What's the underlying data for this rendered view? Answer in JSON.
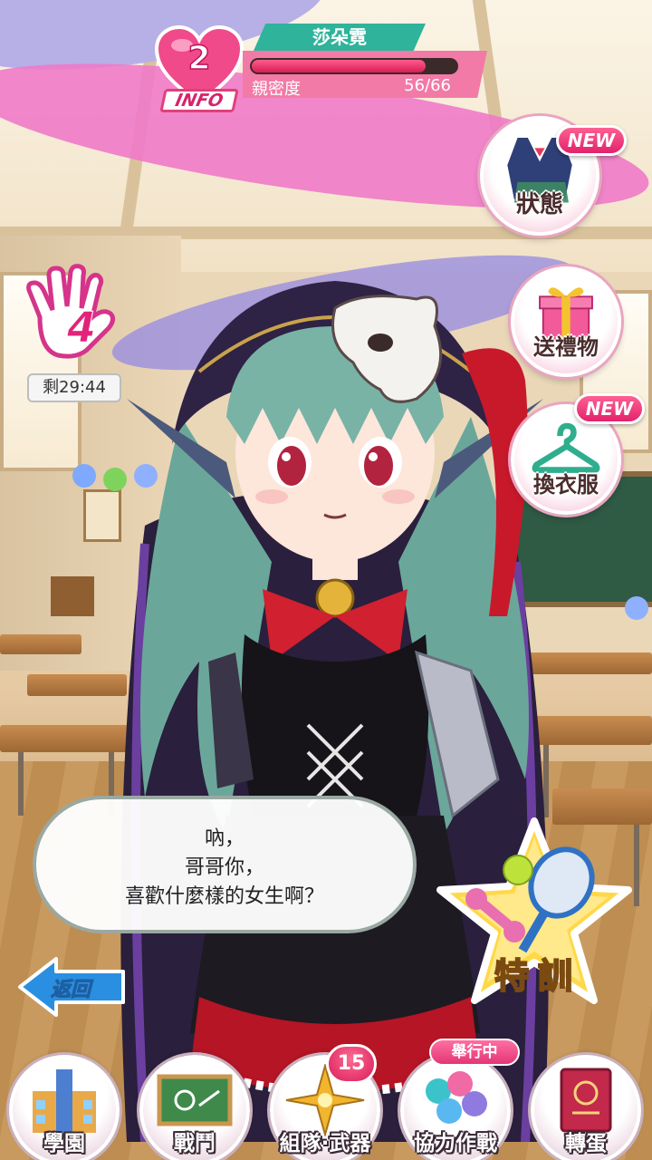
{
  "character": {
    "name": "莎朵霓",
    "affection_level": "2",
    "info_label": "INFO",
    "intimacy_label": "親密度",
    "intimacy_value": "56/66",
    "intimacy_fraction": 0.848
  },
  "stamina": {
    "count": "4",
    "timer": "剩29:44"
  },
  "side_menu": {
    "status": {
      "label": "狀態",
      "badge": "NEW"
    },
    "gift": {
      "label": "送禮物"
    },
    "outfit": {
      "label": "換衣服",
      "badge": "NEW"
    }
  },
  "dialogue": {
    "lines": [
      "吶，",
      "哥哥你，",
      "喜歡什麼樣的女生啊？"
    ]
  },
  "special_training": {
    "label": "特訓"
  },
  "back": {
    "label": "返回"
  },
  "bottom_nav": {
    "items": [
      {
        "label": "學園"
      },
      {
        "label": "戰鬥"
      },
      {
        "label": "組隊·武器",
        "badge": "15"
      },
      {
        "label": "協力作戰",
        "tag": "舉行中"
      },
      {
        "label": "轉蛋"
      }
    ]
  },
  "colors": {
    "accent_pink": "#e3237b",
    "name_banner": "#2fb39a",
    "back_blue": "#2a8fe0"
  }
}
